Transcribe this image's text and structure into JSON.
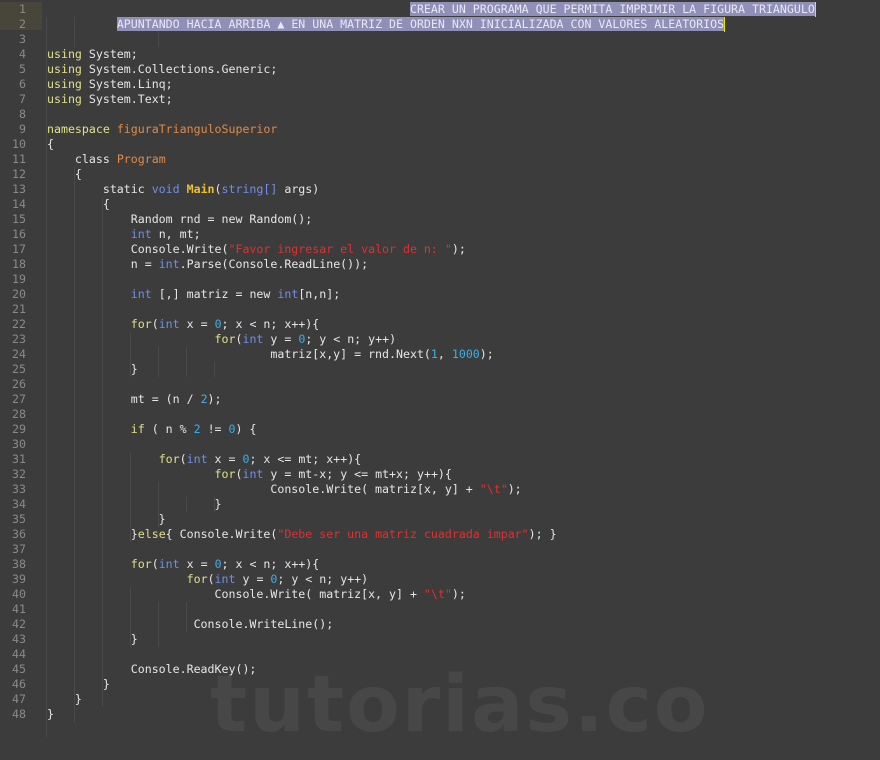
{
  "editor": {
    "language": "C#",
    "colors": {
      "background": "#3c3c3c",
      "selection": "#8f8fb8",
      "keyword": "#e0e08a",
      "type": "#6f8fe8",
      "class_name": "#e08a48",
      "method": "#f0c030",
      "string": "#e03030",
      "number": "#3ab0e8",
      "line_number": "#8a8a8a"
    },
    "lines": [
      {
        "n": "1",
        "tokens": [
          {
            "t": "                                                    ",
            "c": "pl"
          },
          {
            "t": "CREAR UN PROGRAMA QUE PERMITA IMPRIMIR LA FIGURA TRIANGULO",
            "c": "sel"
          }
        ]
      },
      {
        "n": "2",
        "tokens": [
          {
            "t": "          ",
            "c": "pl"
          },
          {
            "t": "APUNTANDO HACIA ARRIBA ▲ EN UNA MATRIZ DE ORDEN NXN INICIALIZADA CON VALORES ALEATORIOS",
            "c": "sel"
          }
        ]
      },
      {
        "n": "3",
        "tokens": []
      },
      {
        "n": "4",
        "tokens": [
          {
            "t": "using",
            "c": "kw"
          },
          {
            "t": " System;",
            "c": "pl"
          }
        ]
      },
      {
        "n": "5",
        "tokens": [
          {
            "t": "using",
            "c": "kw"
          },
          {
            "t": " System.Collections.Generic;",
            "c": "pl"
          }
        ]
      },
      {
        "n": "6",
        "tokens": [
          {
            "t": "using",
            "c": "kw"
          },
          {
            "t": " System.Linq;",
            "c": "pl"
          }
        ]
      },
      {
        "n": "7",
        "tokens": [
          {
            "t": "using",
            "c": "kw"
          },
          {
            "t": " System.Text;",
            "c": "pl"
          }
        ]
      },
      {
        "n": "8",
        "tokens": []
      },
      {
        "n": "9",
        "tokens": [
          {
            "t": "namespace",
            "c": "kw"
          },
          {
            "t": " ",
            "c": "pl"
          },
          {
            "t": "figuraTrianguloSuperior",
            "c": "cls"
          }
        ]
      },
      {
        "n": "10",
        "tokens": [
          {
            "t": "{",
            "c": "pl"
          }
        ]
      },
      {
        "n": "11",
        "tokens": [
          {
            "t": "    class ",
            "c": "pl"
          },
          {
            "t": "Program",
            "c": "cls"
          }
        ]
      },
      {
        "n": "12",
        "tokens": [
          {
            "t": "    {",
            "c": "pl"
          }
        ]
      },
      {
        "n": "13",
        "tokens": [
          {
            "t": "        static ",
            "c": "pl"
          },
          {
            "t": "void",
            "c": "ty"
          },
          {
            "t": " ",
            "c": "pl"
          },
          {
            "t": "Main",
            "c": "fn"
          },
          {
            "t": "(",
            "c": "pl"
          },
          {
            "t": "string[]",
            "c": "ty"
          },
          {
            "t": " args)",
            "c": "pl"
          }
        ]
      },
      {
        "n": "14",
        "tokens": [
          {
            "t": "        {",
            "c": "pl"
          }
        ]
      },
      {
        "n": "15",
        "tokens": [
          {
            "t": "            Random rnd = new Random();",
            "c": "pl"
          }
        ]
      },
      {
        "n": "16",
        "tokens": [
          {
            "t": "            ",
            "c": "pl"
          },
          {
            "t": "int",
            "c": "ty"
          },
          {
            "t": " n, mt;",
            "c": "pl"
          }
        ]
      },
      {
        "n": "17",
        "tokens": [
          {
            "t": "            Console.Write(",
            "c": "pl"
          },
          {
            "t": "\"Favor ingresar el valor de n: \"",
            "c": "str"
          },
          {
            "t": ");",
            "c": "pl"
          }
        ]
      },
      {
        "n": "18",
        "tokens": [
          {
            "t": "            n = ",
            "c": "pl"
          },
          {
            "t": "int",
            "c": "ty"
          },
          {
            "t": ".Parse(Console.ReadLine());",
            "c": "pl"
          }
        ]
      },
      {
        "n": "19",
        "tokens": []
      },
      {
        "n": "20",
        "tokens": [
          {
            "t": "            ",
            "c": "pl"
          },
          {
            "t": "int",
            "c": "ty"
          },
          {
            "t": " [,] matriz = new ",
            "c": "pl"
          },
          {
            "t": "int",
            "c": "ty"
          },
          {
            "t": "[n,n];",
            "c": "pl"
          }
        ]
      },
      {
        "n": "21",
        "tokens": []
      },
      {
        "n": "22",
        "tokens": [
          {
            "t": "            ",
            "c": "pl"
          },
          {
            "t": "for",
            "c": "kw"
          },
          {
            "t": "(",
            "c": "pl"
          },
          {
            "t": "int",
            "c": "ty"
          },
          {
            "t": " x = ",
            "c": "pl"
          },
          {
            "t": "0",
            "c": "num"
          },
          {
            "t": "; x < n; x++){",
            "c": "pl"
          }
        ]
      },
      {
        "n": "23",
        "tokens": [
          {
            "t": "                        ",
            "c": "pl"
          },
          {
            "t": "for",
            "c": "kw"
          },
          {
            "t": "(",
            "c": "pl"
          },
          {
            "t": "int",
            "c": "ty"
          },
          {
            "t": " y = ",
            "c": "pl"
          },
          {
            "t": "0",
            "c": "num"
          },
          {
            "t": "; y < n; y++)",
            "c": "pl"
          }
        ]
      },
      {
        "n": "24",
        "tokens": [
          {
            "t": "                                matriz[x,y] = rnd.Next(",
            "c": "pl"
          },
          {
            "t": "1",
            "c": "num"
          },
          {
            "t": ", ",
            "c": "pl"
          },
          {
            "t": "1000",
            "c": "num"
          },
          {
            "t": ");",
            "c": "pl"
          }
        ]
      },
      {
        "n": "25",
        "tokens": [
          {
            "t": "            }",
            "c": "pl"
          }
        ]
      },
      {
        "n": "26",
        "tokens": []
      },
      {
        "n": "27",
        "tokens": [
          {
            "t": "            mt = (n / ",
            "c": "pl"
          },
          {
            "t": "2",
            "c": "num"
          },
          {
            "t": ");",
            "c": "pl"
          }
        ]
      },
      {
        "n": "28",
        "tokens": []
      },
      {
        "n": "29",
        "tokens": [
          {
            "t": "            ",
            "c": "pl"
          },
          {
            "t": "if",
            "c": "kw"
          },
          {
            "t": " ( n % ",
            "c": "pl"
          },
          {
            "t": "2",
            "c": "num"
          },
          {
            "t": " != ",
            "c": "pl"
          },
          {
            "t": "0",
            "c": "num"
          },
          {
            "t": ") {",
            "c": "pl"
          }
        ]
      },
      {
        "n": "30",
        "tokens": []
      },
      {
        "n": "31",
        "tokens": [
          {
            "t": "                ",
            "c": "pl"
          },
          {
            "t": "for",
            "c": "kw"
          },
          {
            "t": "(",
            "c": "pl"
          },
          {
            "t": "int",
            "c": "ty"
          },
          {
            "t": " x = ",
            "c": "pl"
          },
          {
            "t": "0",
            "c": "num"
          },
          {
            "t": "; x <= mt; x++){",
            "c": "pl"
          }
        ]
      },
      {
        "n": "32",
        "tokens": [
          {
            "t": "                        ",
            "c": "pl"
          },
          {
            "t": "for",
            "c": "kw"
          },
          {
            "t": "(",
            "c": "pl"
          },
          {
            "t": "int",
            "c": "ty"
          },
          {
            "t": " y = mt-x; y <= mt+x; y++){",
            "c": "pl"
          }
        ]
      },
      {
        "n": "33",
        "tokens": [
          {
            "t": "                                Console.Write( matriz[x, y] + ",
            "c": "pl"
          },
          {
            "t": "\"\\t\"",
            "c": "str"
          },
          {
            "t": ");",
            "c": "pl"
          }
        ]
      },
      {
        "n": "34",
        "tokens": [
          {
            "t": "                        }",
            "c": "pl"
          }
        ]
      },
      {
        "n": "35",
        "tokens": [
          {
            "t": "                }",
            "c": "pl"
          }
        ]
      },
      {
        "n": "36",
        "tokens": [
          {
            "t": "            }",
            "c": "pl"
          },
          {
            "t": "else",
            "c": "kw"
          },
          {
            "t": "{ Console.Write(",
            "c": "pl"
          },
          {
            "t": "\"Debe ser una matriz cuadrada impar\"",
            "c": "str"
          },
          {
            "t": "); }",
            "c": "pl"
          }
        ]
      },
      {
        "n": "37",
        "tokens": []
      },
      {
        "n": "38",
        "tokens": [
          {
            "t": "            ",
            "c": "pl"
          },
          {
            "t": "for",
            "c": "kw"
          },
          {
            "t": "(",
            "c": "pl"
          },
          {
            "t": "int",
            "c": "ty"
          },
          {
            "t": " x = ",
            "c": "pl"
          },
          {
            "t": "0",
            "c": "num"
          },
          {
            "t": "; x < n; x++){",
            "c": "pl"
          }
        ]
      },
      {
        "n": "39",
        "tokens": [
          {
            "t": "                    ",
            "c": "pl"
          },
          {
            "t": "for",
            "c": "kw"
          },
          {
            "t": "(",
            "c": "pl"
          },
          {
            "t": "int",
            "c": "ty"
          },
          {
            "t": " y = ",
            "c": "pl"
          },
          {
            "t": "0",
            "c": "num"
          },
          {
            "t": "; y < n; y++)",
            "c": "pl"
          }
        ]
      },
      {
        "n": "40",
        "tokens": [
          {
            "t": "                        Console.Write( matriz[x, y] + ",
            "c": "pl"
          },
          {
            "t": "\"\\t\"",
            "c": "str"
          },
          {
            "t": ");",
            "c": "pl"
          }
        ]
      },
      {
        "n": "41",
        "tokens": []
      },
      {
        "n": "42",
        "tokens": [
          {
            "t": "                     Console.WriteLine();",
            "c": "pl"
          }
        ]
      },
      {
        "n": "43",
        "tokens": [
          {
            "t": "            }",
            "c": "pl"
          }
        ]
      },
      {
        "n": "44",
        "tokens": []
      },
      {
        "n": "45",
        "tokens": [
          {
            "t": "            Console.ReadKey();",
            "c": "pl"
          }
        ]
      },
      {
        "n": "46",
        "tokens": [
          {
            "t": "        }",
            "c": "pl"
          }
        ]
      },
      {
        "n": "47",
        "tokens": [
          {
            "t": "    }",
            "c": "pl"
          }
        ]
      },
      {
        "n": "48",
        "tokens": [
          {
            "t": "}",
            "c": "pl"
          }
        ]
      }
    ]
  },
  "watermark": {
    "text": "tutorias.co"
  }
}
